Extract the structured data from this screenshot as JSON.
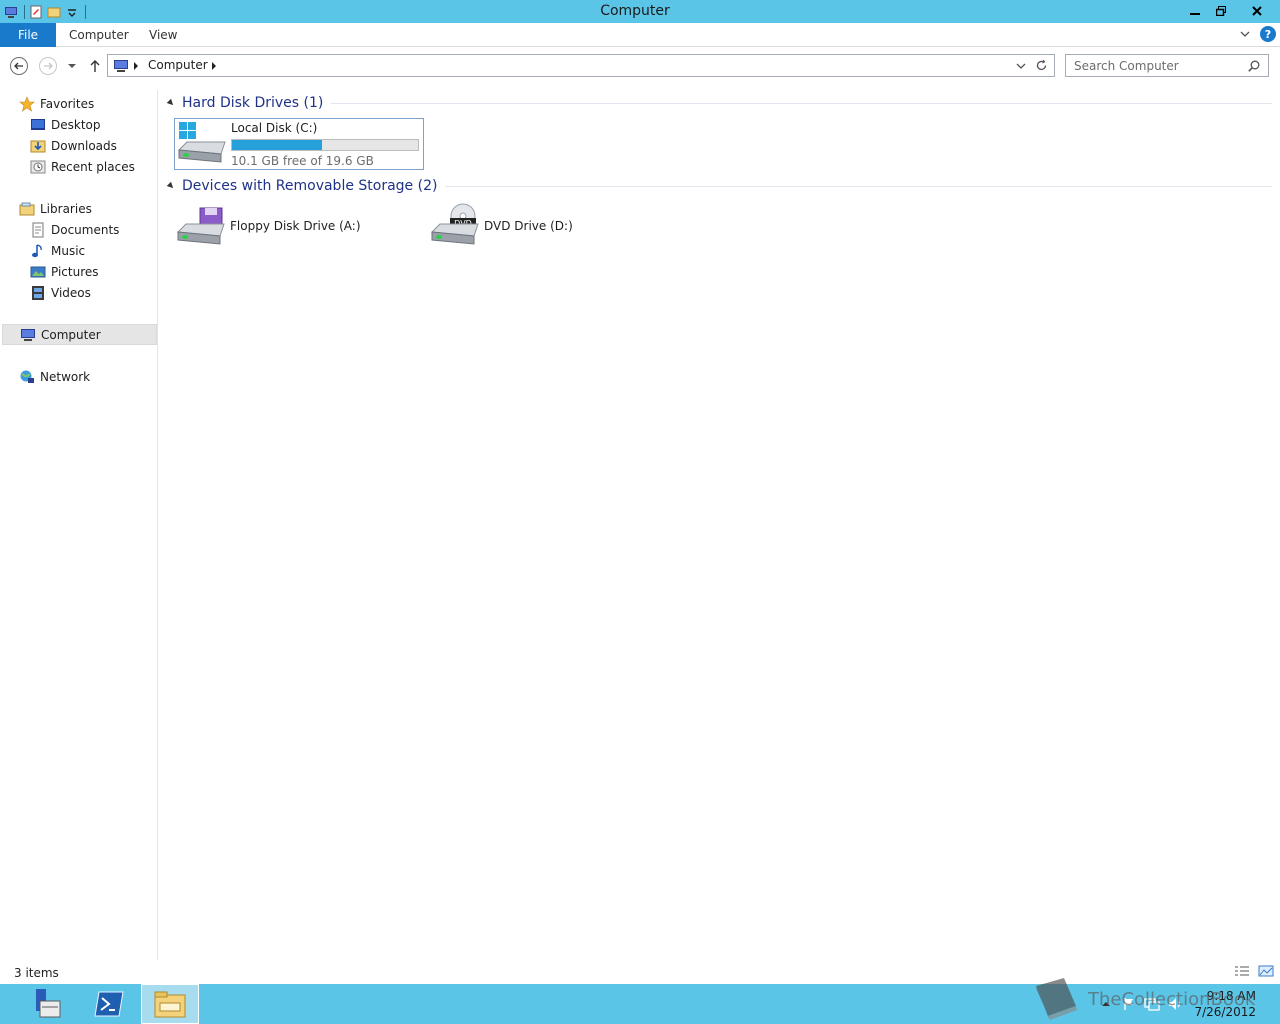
{
  "window": {
    "title": "Computer"
  },
  "ribbon": {
    "tabs": [
      "File",
      "Computer",
      "View"
    ]
  },
  "address": {
    "crumb": "Computer"
  },
  "search": {
    "placeholder": "Search Computer"
  },
  "nav": {
    "favorites": "Favorites",
    "favorite_items": [
      "Desktop",
      "Downloads",
      "Recent places"
    ],
    "libraries": "Libraries",
    "library_items": [
      "Documents",
      "Music",
      "Pictures",
      "Videos"
    ],
    "computer": "Computer",
    "network": "Network"
  },
  "groups": [
    {
      "title": "Hard Disk Drives (1)",
      "drives": [
        {
          "name": "Local Disk (C:)",
          "free": "10.1 GB free of 19.6 GB",
          "used_fraction": 0.485
        }
      ]
    },
    {
      "title": "Devices with Removable Storage (2)",
      "drives": [
        {
          "name": "Floppy Disk Drive (A:)"
        },
        {
          "name": "DVD Drive (D:)",
          "badge": "DVD"
        }
      ]
    }
  ],
  "status": {
    "items": "3 items"
  },
  "taskbar": {
    "time": "9:18 AM",
    "date": "7/26/2012"
  },
  "watermark": "TheCollectionBook",
  "colors": {
    "titlebar": "#5bc5e8",
    "file_tab": "#1979ca",
    "usage_bar": "#26a0da",
    "group_title": "#1e3287"
  }
}
